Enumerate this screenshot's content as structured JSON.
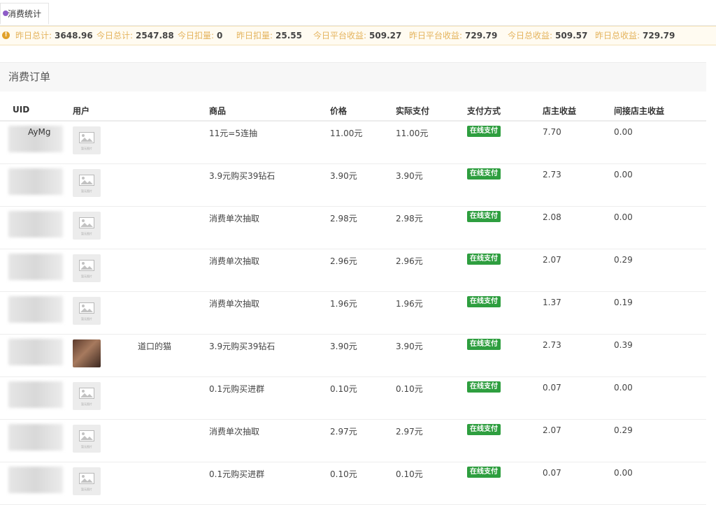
{
  "tab": {
    "label": "消费统计"
  },
  "stats": [
    {
      "label": "昨日总计:",
      "value": "3648.96"
    },
    {
      "label": "今日总计:",
      "value": "2547.88"
    },
    {
      "label": "今日扣量:",
      "value": "0"
    },
    {
      "label": "昨日扣量:",
      "value": "25.55"
    },
    {
      "label": "今日平台收益:",
      "value": "509.27"
    },
    {
      "label": "昨日平台收益:",
      "value": "729.79"
    },
    {
      "label": "今日总收益:",
      "value": "509.57"
    },
    {
      "label": "昨日总收益:",
      "value": "729.79"
    }
  ],
  "section": {
    "title": "消费订单"
  },
  "table": {
    "headers": [
      "UID",
      "用户",
      "商品",
      "价格",
      "实际支付",
      "支付方式",
      "店主收益",
      "间接店主收益"
    ],
    "rows": [
      {
        "uid": "AyMg",
        "user": "",
        "avatar": "placeholder",
        "product": "11元=5连抽",
        "price": "11.00元",
        "paid": "11.00元",
        "method": "在线支付",
        "income": "7.70",
        "indirect": "0.00"
      },
      {
        "uid": "",
        "user": "",
        "avatar": "placeholder",
        "product": "3.9元购买39钻石",
        "price": "3.90元",
        "paid": "3.90元",
        "method": "在线支付",
        "income": "2.73",
        "indirect": "0.00"
      },
      {
        "uid": "",
        "user": "",
        "avatar": "placeholder",
        "product": "消费单次抽取",
        "price": "2.98元",
        "paid": "2.98元",
        "method": "在线支付",
        "income": "2.08",
        "indirect": "0.00"
      },
      {
        "uid": "",
        "user": "",
        "avatar": "placeholder",
        "product": "消费单次抽取",
        "price": "2.96元",
        "paid": "2.96元",
        "method": "在线支付",
        "income": "2.07",
        "indirect": "0.29"
      },
      {
        "uid": "",
        "user": "",
        "avatar": "placeholder",
        "product": "消费单次抽取",
        "price": "1.96元",
        "paid": "1.96元",
        "method": "在线支付",
        "income": "1.37",
        "indirect": "0.19"
      },
      {
        "uid": "",
        "user": "道口的猫",
        "avatar": "photo",
        "product": "3.9元购买39钻石",
        "price": "3.90元",
        "paid": "3.90元",
        "method": "在线支付",
        "income": "2.73",
        "indirect": "0.39"
      },
      {
        "uid": "",
        "user": "",
        "avatar": "placeholder",
        "product": "0.1元购买进群",
        "price": "0.10元",
        "paid": "0.10元",
        "method": "在线支付",
        "income": "0.07",
        "indirect": "0.00"
      },
      {
        "uid": "",
        "user": "",
        "avatar": "placeholder",
        "product": "消费单次抽取",
        "price": "2.97元",
        "paid": "2.97元",
        "method": "在线支付",
        "income": "2.07",
        "indirect": "0.29"
      },
      {
        "uid": "",
        "user": "",
        "avatar": "placeholder",
        "product": "0.1元购买进群",
        "price": "0.10元",
        "paid": "0.10元",
        "method": "在线支付",
        "income": "0.07",
        "indirect": "0.00"
      }
    ]
  },
  "colors": {
    "accent": "#8e5cc8",
    "warn": "#e1a12a",
    "stat_label": "#e4b35c",
    "pay_badge": "#2e9e3f"
  }
}
